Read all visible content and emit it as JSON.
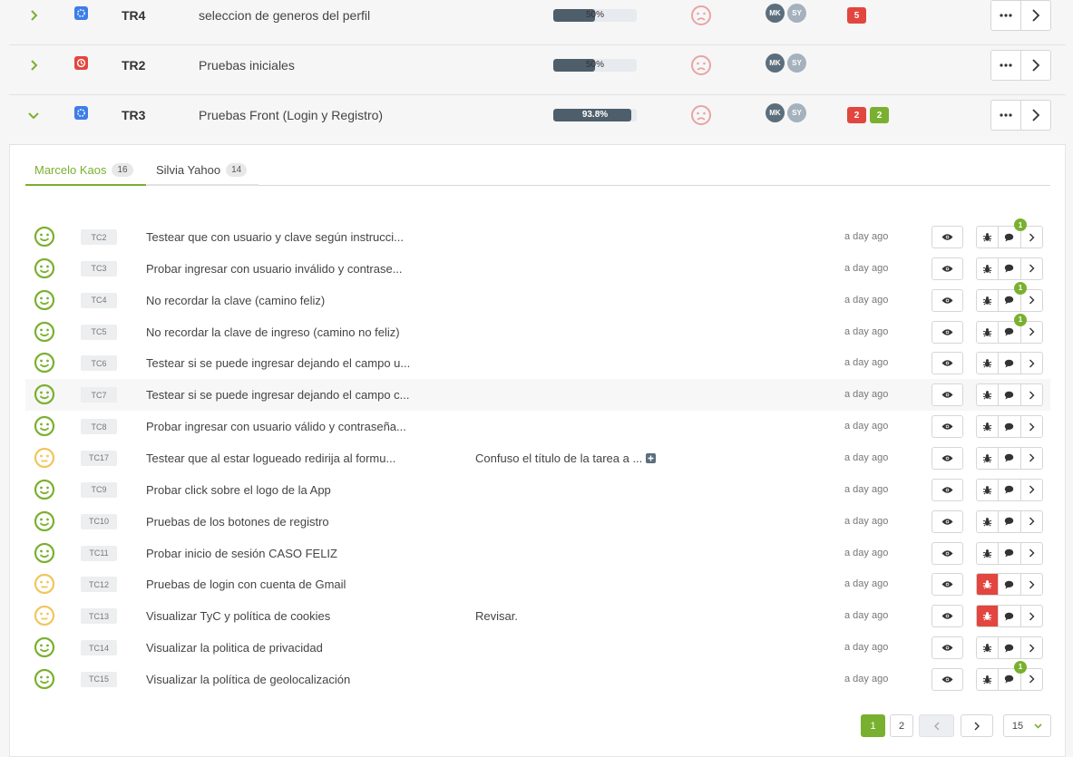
{
  "task_rows": [
    {
      "code": "TR4",
      "title": "seleccion de generos del perfil",
      "progress_label": "50%",
      "progress": 0.5,
      "status": "in-progress-icon",
      "assignees": [
        "MK",
        "SY"
      ],
      "badges": [
        {
          "value": "5",
          "color": "red"
        }
      ],
      "expanded": false
    },
    {
      "code": "TR2",
      "title": "Pruebas iniciales",
      "progress_label": "50%",
      "progress": 0.5,
      "status": "clock-icon",
      "assignees": [
        "MK",
        "SY"
      ],
      "badges": [],
      "expanded": false
    },
    {
      "code": "TR3",
      "title": "Pruebas Front (Login y Registro)",
      "progress_label": "93.8%",
      "progress": 0.938,
      "status": "in-progress-icon",
      "assignees": [
        "MK",
        "SY"
      ],
      "badges": [
        {
          "value": "2",
          "color": "red"
        },
        {
          "value": "2",
          "color": "green"
        }
      ],
      "expanded": true
    }
  ],
  "tabs": [
    {
      "label": "Marcelo Kaos",
      "count": "16",
      "active": true
    },
    {
      "label": "Silvia Yahoo",
      "count": "14",
      "active": false
    }
  ],
  "cases": [
    {
      "code": "TC2",
      "title": "Testear que con usuario y clave según instrucci...",
      "note": "",
      "time": "a day ago",
      "mood": "happy",
      "bug": false,
      "comments": "1"
    },
    {
      "code": "TC3",
      "title": "Probar ingresar con usuario inválido y contrase...",
      "note": "",
      "time": "a day ago",
      "mood": "happy",
      "bug": false,
      "comments": ""
    },
    {
      "code": "TC4",
      "title": "No recordar la clave (camino feliz)",
      "note": "",
      "time": "a day ago",
      "mood": "happy",
      "bug": false,
      "comments": "1"
    },
    {
      "code": "TC5",
      "title": "No recordar la clave de ingreso (camino no feliz)",
      "note": "",
      "time": "a day ago",
      "mood": "happy",
      "bug": false,
      "comments": "1"
    },
    {
      "code": "TC6",
      "title": "Testear si se puede ingresar dejando el campo u...",
      "note": "",
      "time": "a day ago",
      "mood": "happy",
      "bug": false,
      "comments": ""
    },
    {
      "code": "TC7",
      "title": "Testear si se puede ingresar dejando el campo c...",
      "note": "",
      "time": "a day ago",
      "mood": "happy",
      "bug": false,
      "comments": ""
    },
    {
      "code": "TC8",
      "title": "Probar ingresar con usuario válido y contraseña...",
      "note": "",
      "time": "a day ago",
      "mood": "happy",
      "bug": false,
      "comments": ""
    },
    {
      "code": "TC17",
      "title": "Testear que al estar logueado redirija al formu...",
      "note": "Confuso el título de la tarea a ...",
      "time": "a day ago",
      "mood": "neutral",
      "bug": false,
      "comments": ""
    },
    {
      "code": "TC9",
      "title": "Probar click sobre el logo de la App",
      "note": "",
      "time": "a day ago",
      "mood": "happy",
      "bug": false,
      "comments": ""
    },
    {
      "code": "TC10",
      "title": "Pruebas de los botones de registro",
      "note": "",
      "time": "a day ago",
      "mood": "happy",
      "bug": false,
      "comments": ""
    },
    {
      "code": "TC11",
      "title": "Probar inicio de sesión CASO FELIZ",
      "note": "",
      "time": "a day ago",
      "mood": "happy",
      "bug": false,
      "comments": ""
    },
    {
      "code": "TC12",
      "title": "Pruebas de login con cuenta de Gmail",
      "note": "",
      "time": "a day ago",
      "mood": "neutral",
      "bug": true,
      "comments": ""
    },
    {
      "code": "TC13",
      "title": "Visualizar TyC y política de cookies",
      "note": "Revisar.",
      "time": "a day ago",
      "mood": "neutral",
      "bug": true,
      "comments": ""
    },
    {
      "code": "TC14",
      "title": "Visualizar la politica de privacidad",
      "note": "",
      "time": "a day ago",
      "mood": "happy",
      "bug": false,
      "comments": ""
    },
    {
      "code": "TC15",
      "title": "Visualizar la política de geolocalización",
      "note": "",
      "time": "a day ago",
      "mood": "happy",
      "bug": false,
      "comments": "1"
    }
  ],
  "pagination": {
    "pages": [
      "1",
      "2"
    ],
    "current": "1",
    "page_size": "15"
  },
  "colors": {
    "accent": "#7ab02f",
    "danger": "#e2463e",
    "info": "#3d7ee8",
    "progress": "#4e5e6b",
    "sad_face": "#e8a4a4",
    "happy_face": "#7ab02f",
    "neutral_face": "#f0c65c"
  }
}
